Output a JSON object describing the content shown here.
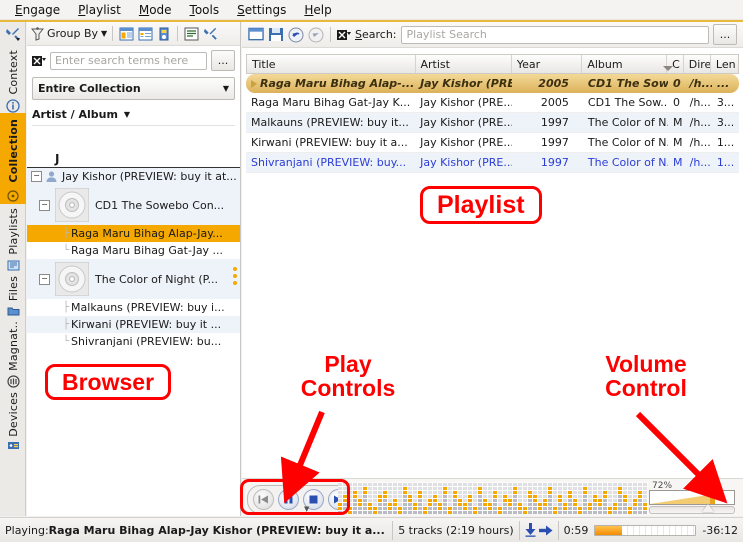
{
  "app": {
    "name": "Amarok"
  },
  "menubar": {
    "items": [
      {
        "label": "Engage",
        "mnemonic": "n"
      },
      {
        "label": "Playlist",
        "mnemonic": "P"
      },
      {
        "label": "Mode",
        "mnemonic": "M"
      },
      {
        "label": "Tools",
        "mnemonic": "T"
      },
      {
        "label": "Settings",
        "mnemonic": "S"
      },
      {
        "label": "Help",
        "mnemonic": "H"
      }
    ]
  },
  "sidebar": {
    "tabs": [
      {
        "label": "Context",
        "icon": "info-icon",
        "active": false
      },
      {
        "label": "Collection",
        "icon": "collection-icon",
        "active": true
      },
      {
        "label": "Playlists",
        "icon": "playlists-icon",
        "active": false
      },
      {
        "label": "Files",
        "icon": "folder-icon",
        "active": false
      },
      {
        "label": "Magnat..",
        "icon": "magnatune-icon",
        "active": false
      },
      {
        "label": "Devices",
        "icon": "devices-icon",
        "active": false
      }
    ],
    "top_tool": "wrench-icon"
  },
  "browser": {
    "toolbar": {
      "group_by_label": "Group By",
      "group_by_icon": "funnel-icon",
      "view_icons": [
        "view-list-icon",
        "view-details-icon",
        "view-single-icon"
      ],
      "right_icons": [
        "view-compact-icon",
        "tools-icon"
      ]
    },
    "search": {
      "placeholder": "Enter search terms here",
      "value": "",
      "clear_icon": "clear-search-icon",
      "more_label": "..."
    },
    "collection_filter": {
      "selected": "Entire Collection"
    },
    "sort_label": "Artist / Album",
    "tree": {
      "section_letter": "J",
      "artist": "Jay Kishor (PREVIEW: buy it at...",
      "albums": [
        {
          "title": "CD1 The Sowebo Con...",
          "tracks": [
            {
              "title": "Raga Maru Bihag Alap-Jay...",
              "selected": true
            },
            {
              "title": "Raga Maru Bihag Gat-Jay ...",
              "selected": false
            }
          ]
        },
        {
          "title": "The Color of Night (P...",
          "tracks": [
            {
              "title": "Malkauns (PREVIEW: buy i...",
              "selected": false
            },
            {
              "title": "Kirwani (PREVIEW: buy it ...",
              "selected": false
            },
            {
              "title": "Shivranjani (PREVIEW: bu...",
              "selected": false
            }
          ]
        }
      ]
    }
  },
  "playlist": {
    "toolbar": {
      "icons": [
        "new-playlist-icon",
        "save-playlist-icon",
        "undo-icon",
        "redo-icon"
      ],
      "search_icon": "clear-search-icon",
      "search_label": "Search:",
      "search_placeholder": "Playlist Search",
      "search_value": "",
      "more_label": "..."
    },
    "columns": [
      "Title",
      "Artist",
      "Year",
      "Album",
      "C",
      "Dire",
      "Len"
    ],
    "rows": [
      {
        "title": "Raga Maru Bihag Alap-...",
        "artist": "Jay Kishor (PRE...",
        "year": "2005",
        "album": "CD1 The Sow...",
        "c": "0",
        "dir": "/h...",
        "len": "...",
        "state": "playing"
      },
      {
        "title": "Raga Maru Bihag Gat-Jay K...",
        "artist": "Jay Kishor (PRE...",
        "year": "2005",
        "album": "CD1 The Sow...",
        "c": "0",
        "dir": "/h...",
        "len": "3...",
        "state": "normal"
      },
      {
        "title": "Malkauns (PREVIEW: buy it...",
        "artist": "Jay Kishor (PRE...",
        "year": "1997",
        "album": "The Color of N...",
        "c": "M",
        "dir": "/h...",
        "len": "3...",
        "state": "alt"
      },
      {
        "title": "Kirwani (PREVIEW: buy it a...",
        "artist": "Jay Kishor (PRE...",
        "year": "1997",
        "album": "The Color of N...",
        "c": "M",
        "dir": "/h...",
        "len": "1...",
        "state": "normal"
      },
      {
        "title": "Shivranjani (PREVIEW: buy...",
        "artist": "Jay Kishor (PRE...",
        "year": "1997",
        "album": "The Color of N...",
        "c": "M",
        "dir": "/h...",
        "len": "1...",
        "state": "selected"
      }
    ]
  },
  "controls": {
    "buttons": [
      {
        "name": "previous-button",
        "icon": "skip-backward-icon",
        "enabled": false
      },
      {
        "name": "pause-button",
        "icon": "pause-icon",
        "enabled": true
      },
      {
        "name": "stop-button",
        "icon": "stop-icon",
        "enabled": true
      },
      {
        "name": "next-button",
        "icon": "skip-forward-icon",
        "enabled": true
      }
    ],
    "volume": {
      "percent_label": "72%",
      "value": 72
    }
  },
  "statusbar": {
    "playing_prefix": "Playing: ",
    "playing_track": "Raga Maru Bihag Alap-Jay Kishor (PREVIEW: buy it a...",
    "track_count": "5 tracks (2:19 hours)",
    "elapsed": "0:59",
    "remaining": "-36:12",
    "progress_percent": 27,
    "arrow_icons": [
      "download-arrow-icon",
      "forward-arrow-icon"
    ]
  },
  "annotations": [
    {
      "id": "browser",
      "label": "Browser",
      "boxed": true
    },
    {
      "id": "playlist",
      "label": "Playlist",
      "boxed": true
    },
    {
      "id": "play-controls",
      "label_line1": "Play",
      "label_line2": "Controls",
      "boxed": false
    },
    {
      "id": "volume-control",
      "label_line1": "Volume",
      "label_line2": "Control",
      "boxed": false
    }
  ],
  "colors": {
    "accent": "#f5a800",
    "annotation": "#ff0000",
    "selection_blue": "#2a3cd6",
    "playing_gold": "#e2b85a"
  }
}
